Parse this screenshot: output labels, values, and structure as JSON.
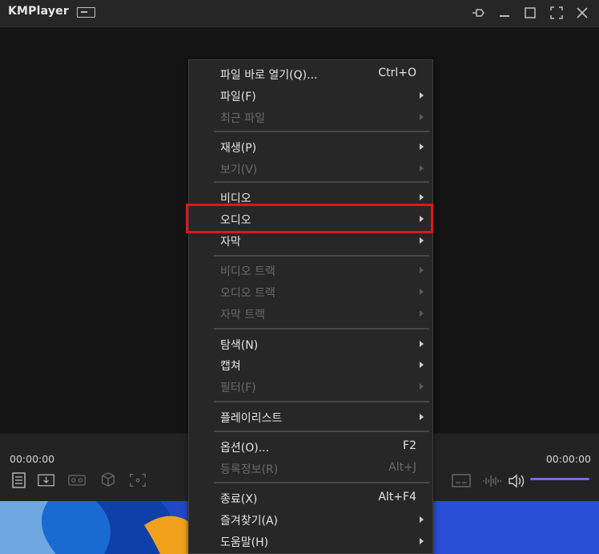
{
  "app": {
    "title": "KMPlayer"
  },
  "controls": {
    "time_current": "00:00:00",
    "time_total": "00:00:00"
  },
  "menu": {
    "items": [
      {
        "label": "파일 바로 열기(Q)...",
        "shortcut": "Ctrl+O",
        "submenu": false,
        "disabled": false
      },
      {
        "label": "파일(F)",
        "shortcut": "",
        "submenu": true,
        "disabled": false
      },
      {
        "label": "최근 파일",
        "shortcut": "",
        "submenu": true,
        "disabled": true
      },
      {
        "label": "재생(P)",
        "shortcut": "",
        "submenu": true,
        "disabled": false
      },
      {
        "label": "보기(V)",
        "shortcut": "",
        "submenu": true,
        "disabled": true
      },
      {
        "label": "비디오",
        "shortcut": "",
        "submenu": true,
        "disabled": false
      },
      {
        "label": "오디오",
        "shortcut": "",
        "submenu": true,
        "disabled": false,
        "highlighted": true
      },
      {
        "label": "자막",
        "shortcut": "",
        "submenu": true,
        "disabled": false
      },
      {
        "label": "비디오 트랙",
        "shortcut": "",
        "submenu": true,
        "disabled": true
      },
      {
        "label": "오디오 트랙",
        "shortcut": "",
        "submenu": true,
        "disabled": true
      },
      {
        "label": "자막 트랙",
        "shortcut": "",
        "submenu": true,
        "disabled": true
      },
      {
        "label": "탐색(N)",
        "shortcut": "",
        "submenu": true,
        "disabled": false
      },
      {
        "label": "캡쳐",
        "shortcut": "",
        "submenu": true,
        "disabled": false
      },
      {
        "label": "필터(F)",
        "shortcut": "",
        "submenu": true,
        "disabled": true
      },
      {
        "label": "플레이리스트",
        "shortcut": "",
        "submenu": true,
        "disabled": false
      },
      {
        "label": "옵션(O)...",
        "shortcut": "F2",
        "submenu": false,
        "disabled": false
      },
      {
        "label": "등록정보(R)",
        "shortcut": "Alt+J",
        "submenu": false,
        "disabled": true
      },
      {
        "label": "종료(X)",
        "shortcut": "Alt+F4",
        "submenu": false,
        "disabled": false
      },
      {
        "label": "즐겨찾기(A)",
        "shortcut": "",
        "submenu": true,
        "disabled": false
      },
      {
        "label": "도움말(H)",
        "shortcut": "",
        "submenu": true,
        "disabled": false
      }
    ]
  },
  "colors": {
    "highlight_box": "#e0161c",
    "volume_accent": "#7b67e0"
  }
}
